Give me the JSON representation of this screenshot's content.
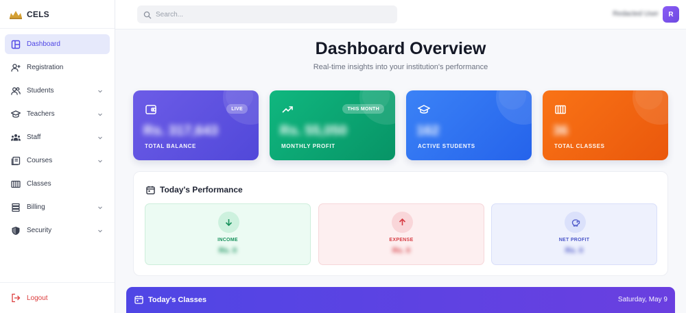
{
  "brand": {
    "name": "CELS"
  },
  "sidebar": {
    "items": [
      {
        "label": "Dashboard",
        "icon": "layout-icon",
        "active": true,
        "expandable": false
      },
      {
        "label": "Registration",
        "icon": "user-plus-icon",
        "expandable": false
      },
      {
        "label": "Students",
        "icon": "users-icon",
        "expandable": true
      },
      {
        "label": "Teachers",
        "icon": "graduation-cap-icon",
        "expandable": true
      },
      {
        "label": "Staff",
        "icon": "team-icon",
        "expandable": true
      },
      {
        "label": "Courses",
        "icon": "book-icon",
        "expandable": true
      },
      {
        "label": "Classes",
        "icon": "columns-icon",
        "expandable": false
      },
      {
        "label": "Billing",
        "icon": "bank-icon",
        "expandable": true
      },
      {
        "label": "Security",
        "icon": "shield-icon",
        "expandable": true
      }
    ],
    "logout_label": "Logout"
  },
  "topbar": {
    "search_placeholder": "Search...",
    "user_name": "Redacted User",
    "avatar_initial": "R"
  },
  "main": {
    "title": "Dashboard Overview",
    "subtitle": "Real-time insights into your institution's performance",
    "stats": [
      {
        "label": "TOTAL BALANCE",
        "value": "Rs. 317,643",
        "badge": "LIVE",
        "icon": "wallet-icon",
        "color": "#5b50e0"
      },
      {
        "label": "MONTHLY PROFIT",
        "value": "Rs. 55,050",
        "badge": "THIS MONTH",
        "icon": "trending-up-icon",
        "color": "#0ea472"
      },
      {
        "label": "ACTIVE STUDENTS",
        "value": "162",
        "badge": "",
        "icon": "graduation-cap-icon",
        "color": "#3076f0"
      },
      {
        "label": "TOTAL CLASSES",
        "value": "36",
        "badge": "",
        "icon": "columns-icon",
        "color": "#f26b1d"
      }
    ],
    "performance": {
      "title": "Today's Performance",
      "items": [
        {
          "label": "INCOME",
          "value": "Rs. 0",
          "icon": "arrow-down-icon",
          "color": "#16905a"
        },
        {
          "label": "EXPENSE",
          "value": "Rs. 0",
          "icon": "arrow-up-icon",
          "color": "#d63c43"
        },
        {
          "label": "NET PROFIT",
          "value": "Rs. 0",
          "icon": "piggy-bank-icon",
          "color": "#4a55c8"
        }
      ]
    },
    "classes": {
      "title": "Today's Classes",
      "date": "Saturday, May 9"
    }
  }
}
